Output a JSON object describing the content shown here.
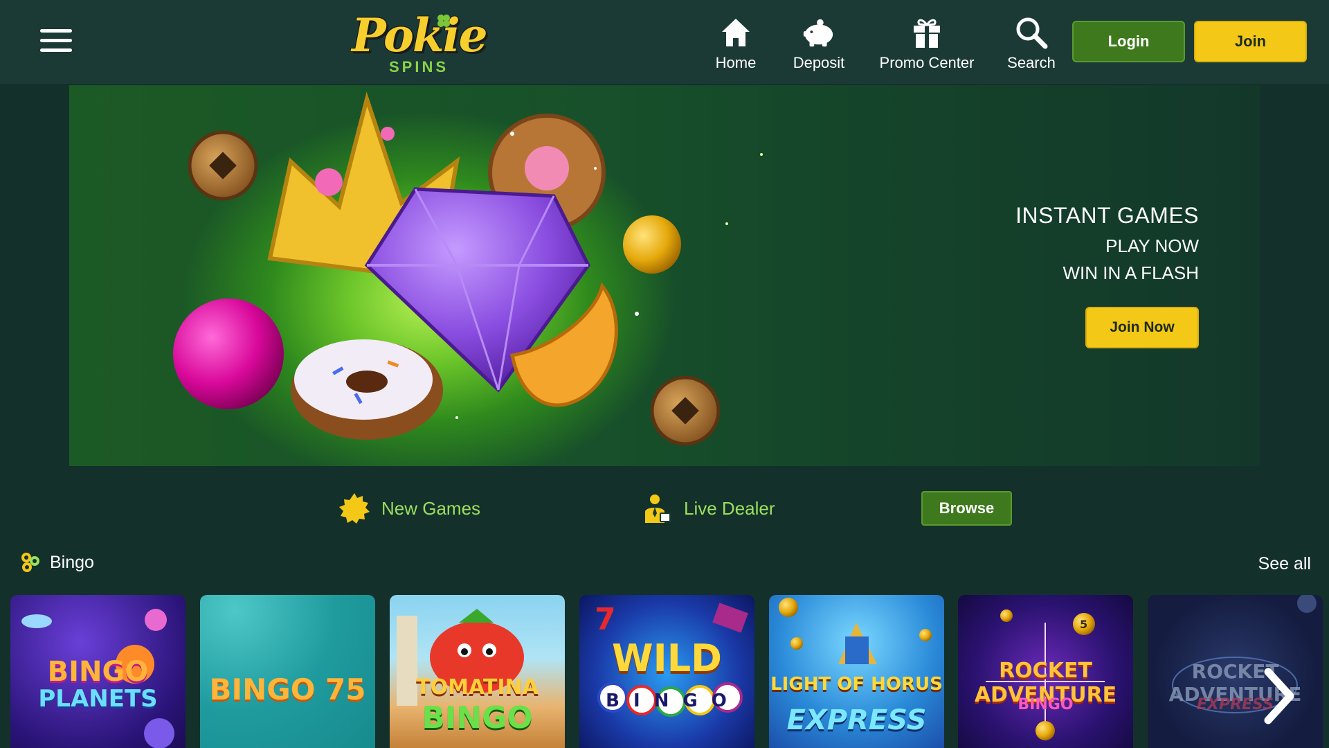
{
  "header": {
    "logo_main": "Pokie",
    "logo_sub": "SPINS",
    "nav": [
      {
        "label": "Home",
        "icon": "home-icon"
      },
      {
        "label": "Deposit",
        "icon": "piggy-bank-icon"
      },
      {
        "label": "Promo Center",
        "icon": "gift-icon"
      },
      {
        "label": "Search",
        "icon": "search-icon"
      }
    ],
    "login_label": "Login",
    "join_label": "Join"
  },
  "banner": {
    "title": "INSTANT GAMES",
    "line1": "PLAY NOW",
    "line2": "WIN IN A FLASH",
    "cta_label": "Join Now"
  },
  "categories": {
    "new_games": "New Games",
    "live_dealer": "Live Dealer",
    "browse_label": "Browse"
  },
  "bingo_section": {
    "title": "Bingo",
    "see_all": "See all",
    "games": [
      {
        "line1": "BINGO",
        "line2": "PLANETS"
      },
      {
        "line1": "BINGO 75",
        "line2": ""
      },
      {
        "line1": "TOMATINA",
        "line2": "BINGO"
      },
      {
        "line1": "WILD",
        "line2": "BINGO"
      },
      {
        "line1": "LIGHT OF HORUS",
        "line2": "EXPRESS"
      },
      {
        "line1": "ROCKET ADVENTURE",
        "line2": "BINGO"
      },
      {
        "line1": "ROCKET ADVENTURE",
        "line2": "EXPRESS"
      }
    ]
  },
  "colors": {
    "background": "#14302b",
    "header": "#1b3a35",
    "accent_yellow": "#f3c817",
    "accent_green": "#3e7a1d",
    "category_text": "#9be05d"
  }
}
